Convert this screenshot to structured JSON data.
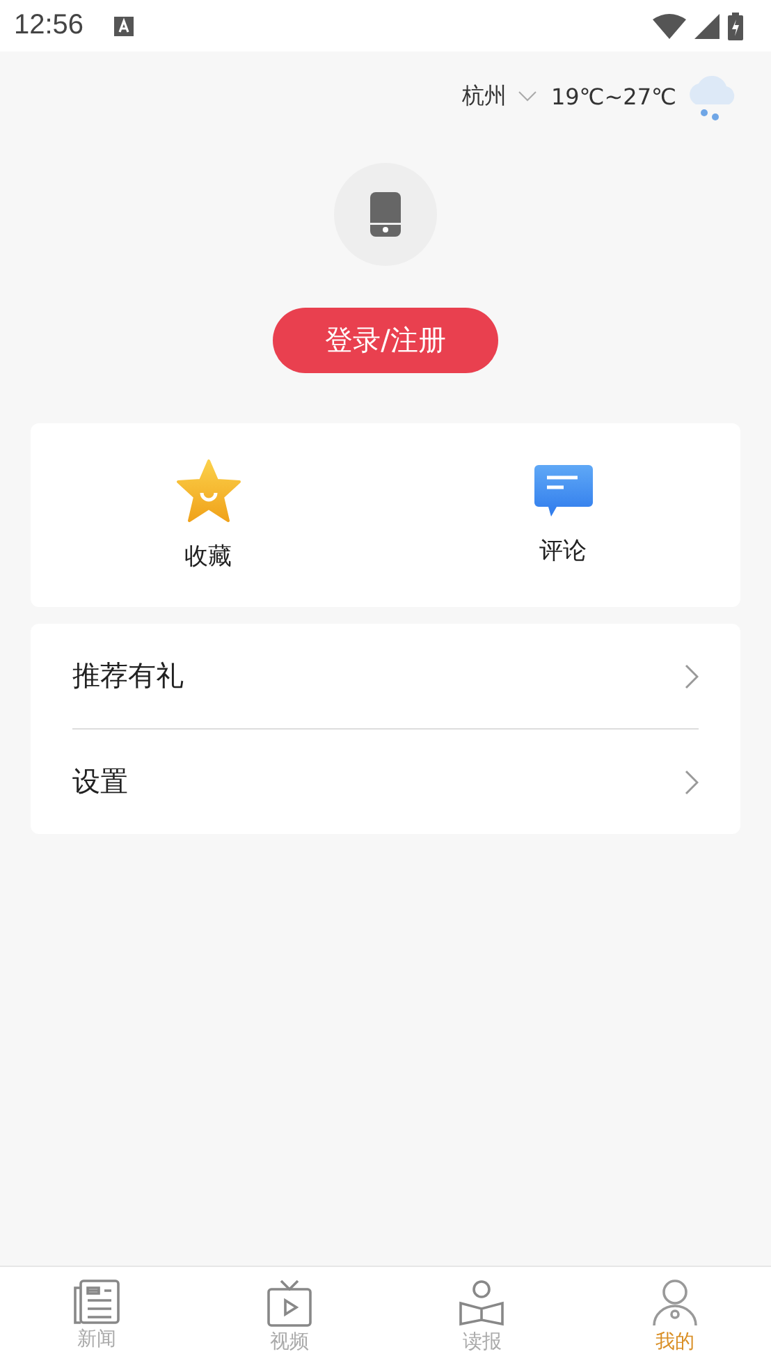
{
  "status_bar": {
    "time": "12:56"
  },
  "weather": {
    "city": "杭州",
    "temperature": "19℃~27℃"
  },
  "login_button": "登录/注册",
  "shortcuts": [
    {
      "kind": "star",
      "label": "收藏"
    },
    {
      "kind": "comment",
      "label": "评论"
    }
  ],
  "menu": [
    {
      "label": "推荐有礼"
    },
    {
      "label": "设置"
    }
  ],
  "tabs": [
    {
      "kind": "news",
      "label": "新闻",
      "selected": false
    },
    {
      "kind": "video",
      "label": "视频",
      "selected": false
    },
    {
      "kind": "read",
      "label": "读报",
      "selected": false
    },
    {
      "kind": "me",
      "label": "我的",
      "selected": true
    }
  ]
}
